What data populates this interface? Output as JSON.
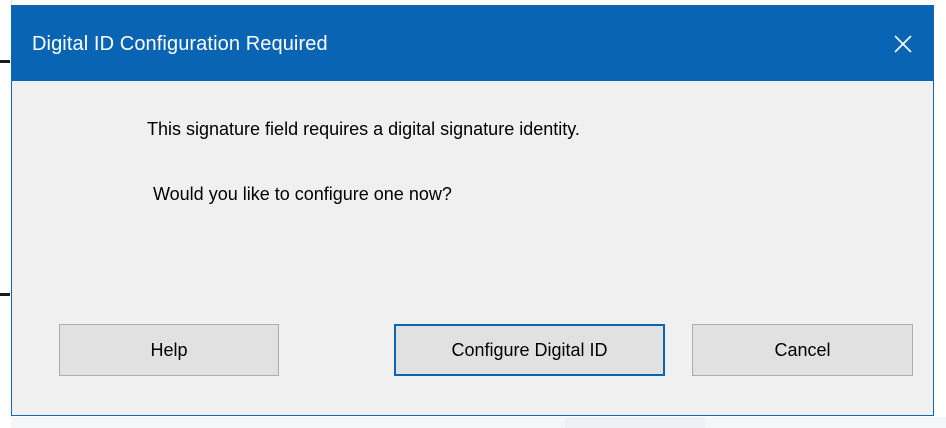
{
  "dialog": {
    "title": "Digital ID Configuration Required",
    "close_icon": "close-icon",
    "message_line1": "This signature field requires a digital signature identity.",
    "message_line2": "Would you like to configure one now?",
    "buttons": {
      "help": "Help",
      "configure": "Configure Digital ID",
      "cancel": "Cancel"
    }
  },
  "colors": {
    "titlebar": "#0a64b4",
    "dialog_body": "#f0f0f0",
    "button_face": "#e1e1e1",
    "default_button_border": "#0a64b4"
  }
}
